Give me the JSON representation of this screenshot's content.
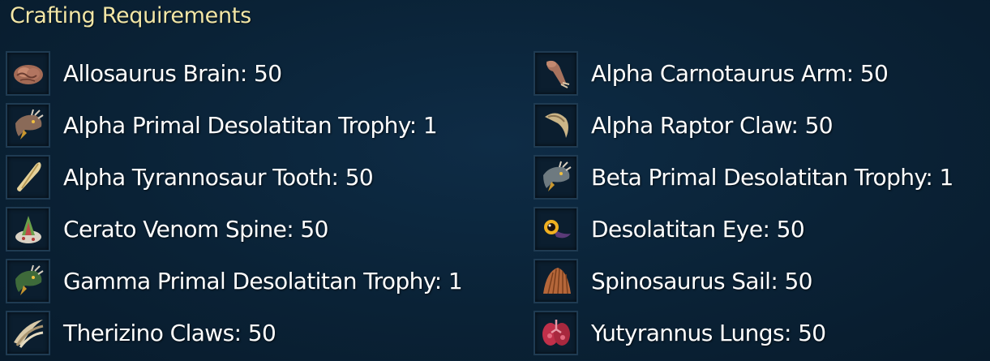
{
  "header": {
    "title": "Crafting Requirements"
  },
  "colors": {
    "title": "#f2e6a6",
    "text": "#ffffff",
    "background": "#0a2236",
    "slot_border": "#1f3b52"
  },
  "requirements": [
    {
      "label": "Allosaurus Brain: 50",
      "icon": "brain-icon"
    },
    {
      "label": "Alpha Carnotaurus Arm: 50",
      "icon": "arm-icon"
    },
    {
      "label": "Alpha Primal Desolatitan Trophy: 1",
      "icon": "trophy-head-icon"
    },
    {
      "label": "Alpha Raptor Claw: 50",
      "icon": "claw-icon"
    },
    {
      "label": "Alpha Tyrannosaur Tooth: 50",
      "icon": "tooth-icon"
    },
    {
      "label": "Beta Primal Desolatitan Trophy: 1",
      "icon": "trophy-head-icon"
    },
    {
      "label": "Cerato Venom Spine: 50",
      "icon": "spine-icon"
    },
    {
      "label": "Desolatitan Eye: 50",
      "icon": "eye-icon"
    },
    {
      "label": "Gamma Primal Desolatitan Trophy: 1",
      "icon": "trophy-head-icon"
    },
    {
      "label": "Spinosaurus Sail: 50",
      "icon": "sail-icon"
    },
    {
      "label": "Therizino Claws: 50",
      "icon": "claws-icon"
    },
    {
      "label": "Yutyrannus Lungs: 50",
      "icon": "lungs-icon"
    }
  ]
}
